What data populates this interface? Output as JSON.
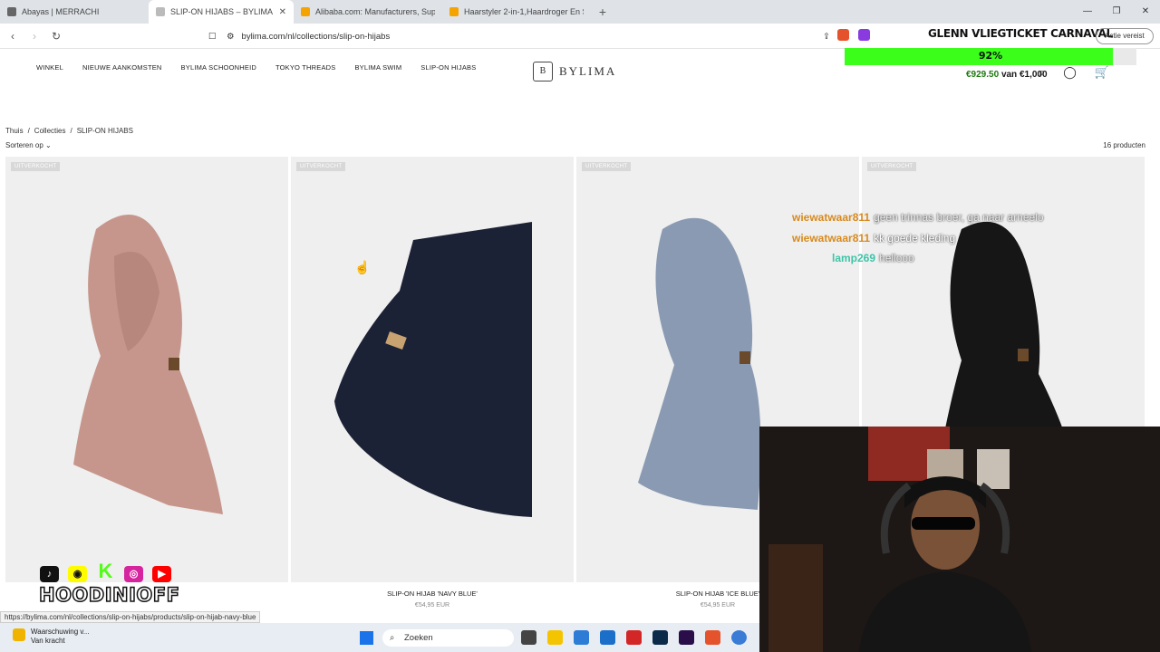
{
  "browser": {
    "tabs": [
      {
        "title": "Abayas | MERRACHI",
        "color": "#666"
      },
      {
        "title": "SLIP-ON HIJABS – BYLIMA",
        "color": "#999",
        "active": true
      },
      {
        "title": "Alibaba.com: Manufacturers, Supplie...",
        "color": "#f5a300"
      },
      {
        "title": "Haarstyler 2-in-1,Haardroger En Stijl...",
        "color": "#f5a300"
      }
    ],
    "new_tab": "+",
    "url": "bylima.com/nl/collections/slip-on-hijabs",
    "action_required": "Actie vereist",
    "status_url": "https://bylima.com/nl/collections/slip-on-hijabs/products/slip-on-hijab-navy-blue"
  },
  "site": {
    "nav": [
      "WINKEL",
      "NIEUWE AANKOMSTEN",
      "BYLIMA SCHOONHEID",
      "TOKYO THREADS",
      "BYLIMA SWIM",
      "SLIP-ON HIJABS"
    ],
    "logo_mark": "B",
    "logo_text": "BYLIMA",
    "breadcrumb": [
      "Thuis",
      "/",
      "Collecties",
      "/",
      "SLIP-ON HIJABS"
    ],
    "sort_label": "Sorteren op",
    "product_count": "16 producten",
    "products": [
      {
        "badge": "UITVERKOCHT",
        "name": "",
        "price": "",
        "color": "#c6968c"
      },
      {
        "badge": "UITVERKOCHT",
        "name": "SLIP-ON HIJAB 'NAVY BLUE'",
        "price": "€54,95 EUR",
        "color": "#1c2236"
      },
      {
        "badge": "UITVERKOCHT",
        "name": "SLIP-ON HIJAB 'ICE BLUE'",
        "price": "€54,95 EUR",
        "color": "#8a9ab3"
      },
      {
        "badge": "UITVERKOCHT",
        "name": "",
        "price": "",
        "color": "#161616"
      }
    ]
  },
  "stream": {
    "goal_title": "GLENN VLIEGTICKET CARNAVAL",
    "goal_percent": "92%",
    "goal_fraction": 0.92,
    "goal_current": "€929.50",
    "goal_sep": "van",
    "goal_target": "€1,000",
    "chat": [
      {
        "user": "wiewatwaar811",
        "msg": "geen trinnas broer, ga naar arneelo"
      },
      {
        "user": "wiewatwaar811",
        "msg": "kk goede kleding"
      },
      {
        "user": "lamp269",
        "msg": "hellooo"
      }
    ],
    "channel": "HOODINIOFF",
    "socials": [
      "tiktok-icon",
      "snapchat-icon",
      "kick-icon",
      "instagram-icon",
      "youtube-icon"
    ]
  },
  "taskbar": {
    "warning_title": "Waarschuwing v...",
    "warning_sub": "Van kracht",
    "search_placeholder": "Zoeken"
  }
}
